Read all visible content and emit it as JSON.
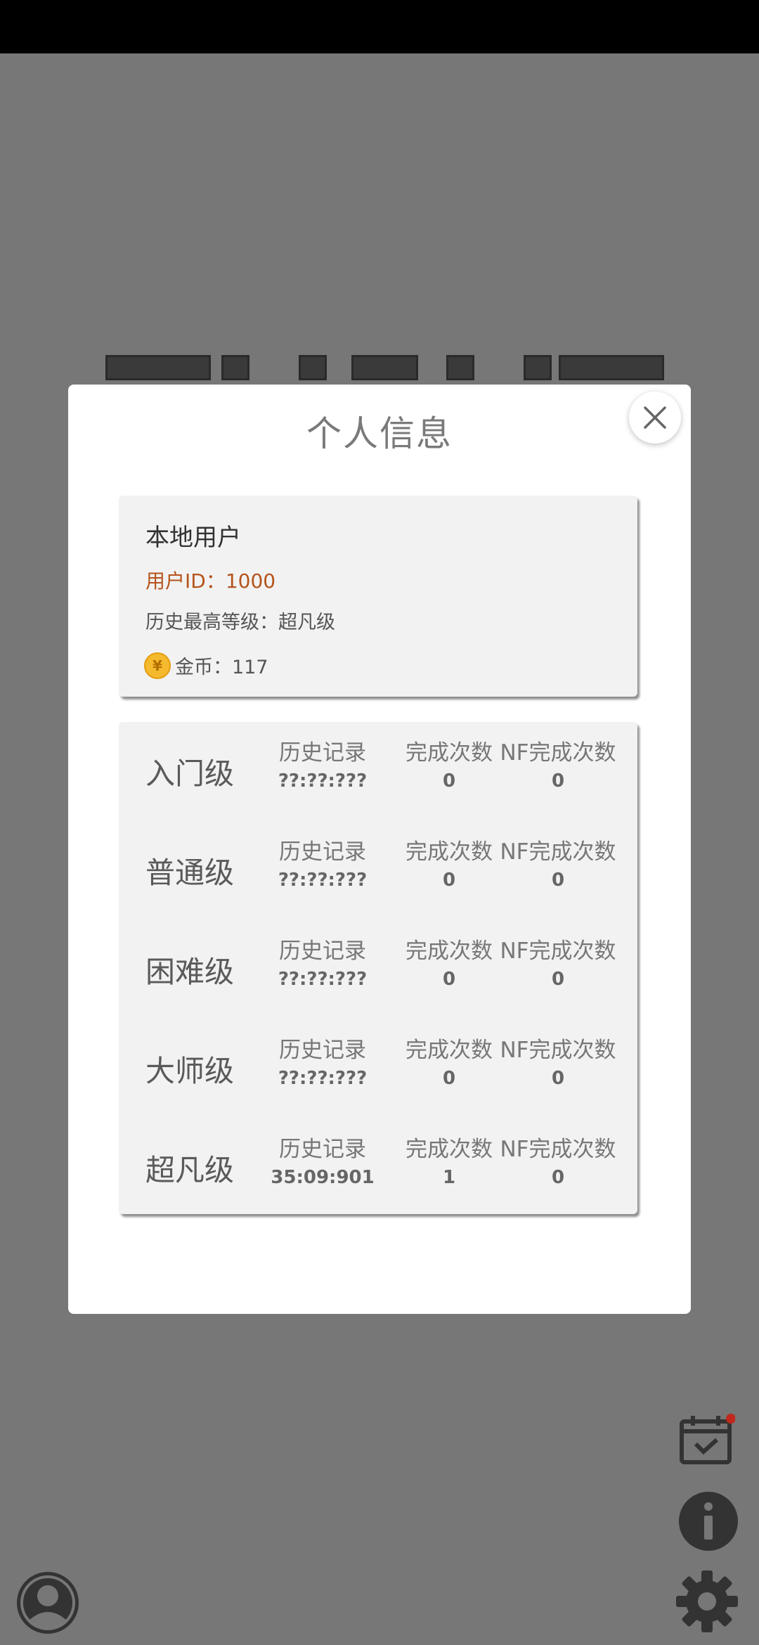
{
  "modal": {
    "title": "个人信息"
  },
  "user": {
    "name": "本地用户",
    "id_text": "用户ID：1000",
    "highest_level_text": "历史最高等级：超凡级",
    "coins_text": "金币：117",
    "coin_symbol": "¥"
  },
  "stats": {
    "rows": [
      {
        "level": "入门级",
        "record_label": "历史记录",
        "record": "??:??:???",
        "done_label": "完成次数",
        "done": "0",
        "nf_label": "NF完成次数",
        "nf": "0"
      },
      {
        "level": "普通级",
        "record_label": "历史记录",
        "record": "??:??:???",
        "done_label": "完成次数",
        "done": "0",
        "nf_label": "NF完成次数",
        "nf": "0"
      },
      {
        "level": "困难级",
        "record_label": "历史记录",
        "record": "??:??:???",
        "done_label": "完成次数",
        "done": "0",
        "nf_label": "NF完成次数",
        "nf": "0"
      },
      {
        "level": "大师级",
        "record_label": "历史记录",
        "record": "??:??:???",
        "done_label": "完成次数",
        "done": "0",
        "nf_label": "NF完成次数",
        "nf": "0"
      },
      {
        "level": "超凡级",
        "record_label": "历史记录",
        "record": "35:09:901",
        "done_label": "完成次数",
        "done": "1",
        "nf_label": "NF完成次数",
        "nf": "0"
      }
    ]
  },
  "icons": {
    "close": "close-icon",
    "calendar": "calendar-check-icon",
    "info": "info-icon",
    "settings": "gear-icon",
    "profile": "user-avatar-icon"
  },
  "colors": {
    "overlay": "#777777",
    "user_id": "#b5541b",
    "coin": "#f5b92d",
    "notification_dot": "#c0281b"
  }
}
